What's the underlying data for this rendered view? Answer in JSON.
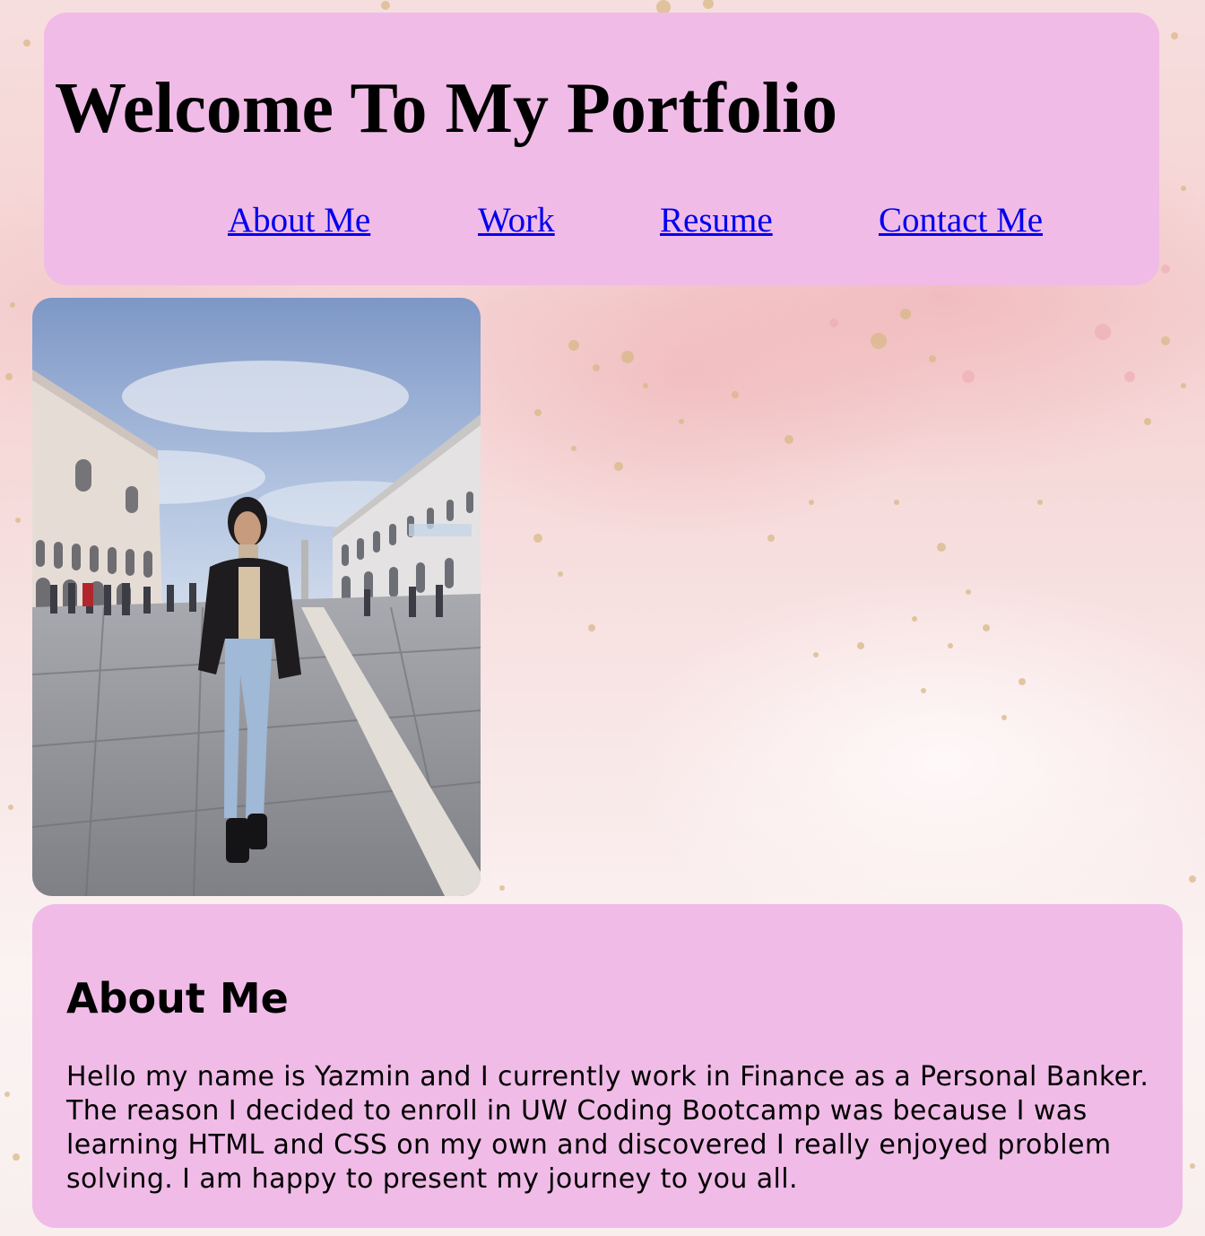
{
  "header": {
    "title": "Welcome To My Portfolio",
    "nav": [
      {
        "label": "About Me"
      },
      {
        "label": "Work"
      },
      {
        "label": "Resume"
      },
      {
        "label": "Contact Me"
      }
    ]
  },
  "photo": {
    "icon": "profile-photo"
  },
  "about": {
    "heading": "About Me",
    "body": "Hello my name is Yazmin and I currently work in Finance as a Personal Banker. The reason I decided to enroll in UW Coding Bootcamp was because I was learning HTML and CSS on my own and discovered I really enjoyed problem solving. I am happy to present my journey to you all."
  },
  "colors": {
    "panel": "#f0bbe7",
    "link": "#0000ee",
    "text": "#000000",
    "background": "#f6dcdc"
  }
}
